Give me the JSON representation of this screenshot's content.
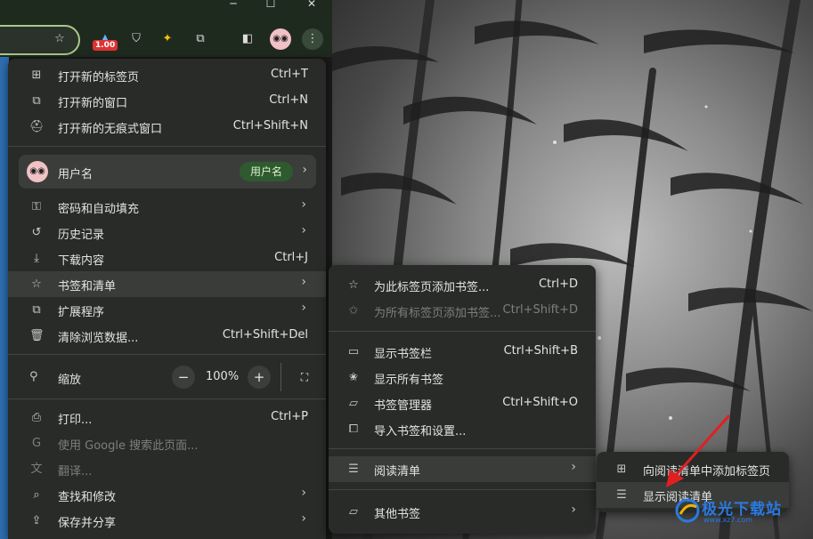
{
  "window": {
    "minimize": "─",
    "maximize": "☐",
    "close": "✕"
  },
  "toolbar": {
    "extension_badge": "1.00",
    "icons": [
      "bookmark-star-icon",
      "ublock-icon",
      "gamepad-extension-icon",
      "pikachu-extension-icon",
      "extensions-puzzle-icon",
      "side-panel-icon",
      "profile-avatar-icon",
      "more-menu-icon"
    ]
  },
  "main_menu": {
    "new_tab": {
      "label": "打开新的标签页",
      "shortcut": "Ctrl+T"
    },
    "new_window": {
      "label": "打开新的窗口",
      "shortcut": "Ctrl+N"
    },
    "new_incognito": {
      "label": "打开新的无痕式窗口",
      "shortcut": "Ctrl+Shift+N"
    },
    "profile": {
      "label": "用户名",
      "pill": "用户名"
    },
    "passwords": {
      "label": "密码和自动填充"
    },
    "history": {
      "label": "历史记录"
    },
    "downloads": {
      "label": "下载内容",
      "shortcut": "Ctrl+J"
    },
    "bookmarks": {
      "label": "书签和清单"
    },
    "extensions": {
      "label": "扩展程序"
    },
    "clear_data": {
      "label": "清除浏览数据...",
      "shortcut": "Ctrl+Shift+Del"
    },
    "zoom": {
      "label": "缩放",
      "minus": "−",
      "value": "100%",
      "plus": "+"
    },
    "print": {
      "label": "打印...",
      "shortcut": "Ctrl+P"
    },
    "search_page": {
      "label": "使用 Google 搜索此页面..."
    },
    "translate": {
      "label": "翻译..."
    },
    "find_edit": {
      "label": "查找和修改"
    },
    "save_share": {
      "label": "保存并分享"
    }
  },
  "bookmarks_menu": {
    "bookmark_tab": {
      "label": "为此标签页添加书签...",
      "shortcut": "Ctrl+D"
    },
    "bookmark_all": {
      "label": "为所有标签页添加书签...",
      "shortcut": "Ctrl+Shift+D"
    },
    "show_bar": {
      "label": "显示书签栏",
      "shortcut": "Ctrl+Shift+B"
    },
    "show_all": {
      "label": "显示所有书签"
    },
    "manager": {
      "label": "书签管理器",
      "shortcut": "Ctrl+Shift+O"
    },
    "import": {
      "label": "导入书签和设置..."
    },
    "reading_list": {
      "label": "阅读清单"
    },
    "other": {
      "label": "其他书签"
    }
  },
  "reading_list_menu": {
    "add_tab": {
      "label": "向阅读清单中添加标签页"
    },
    "show": {
      "label": "显示阅读清单"
    }
  },
  "watermark": {
    "text": "极光下载站",
    "sub": "www.xz7.com"
  },
  "colors": {
    "menu_bg": "#292b29",
    "highlight": "#3a3c3a",
    "pill": "#2f5a2f",
    "annotation": "#e0201f",
    "watermark": "#2a7ae2"
  }
}
